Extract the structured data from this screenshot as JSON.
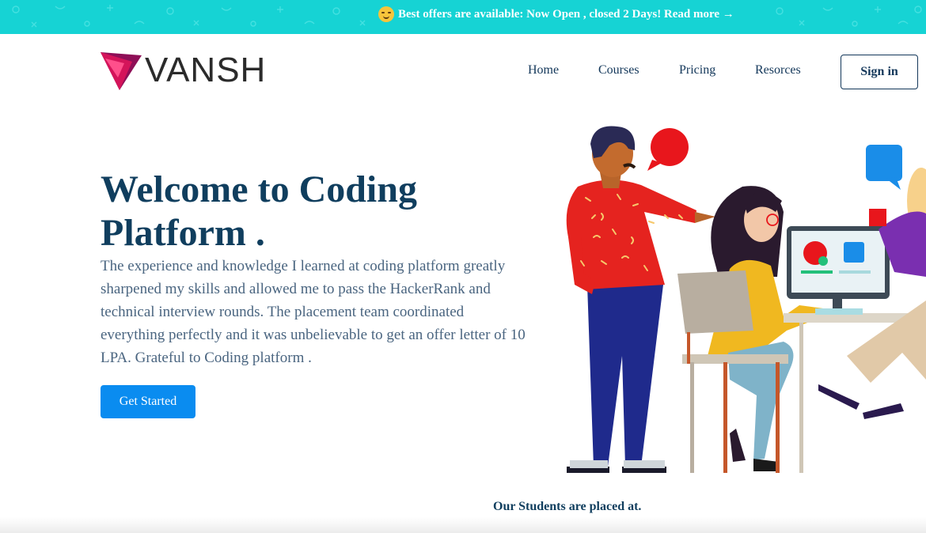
{
  "banner": {
    "text": "Best offers are available: Now Open , closed 2 Days! Read more →",
    "background": "#16d3d4",
    "icon": "grinning-face-emoji"
  },
  "header": {
    "logo_text": "VANSH",
    "nav": [
      "Home",
      "Courses",
      "Pricing",
      "Resorces"
    ],
    "signin_label": "Sign in"
  },
  "hero": {
    "title": "Welcome to Coding Platform .",
    "description": "The experience and knowledge I learned at coding platform greatly sharpened my skills and allowed me to pass the HackerRank and technical interview rounds. The placement team coordinated everything perfectly and it was unbelievable to get an offer letter of 10 LPA. Grateful to Coding platform .",
    "cta_label": "Get Started",
    "cta_color": "#0a8cf0"
  },
  "placed_heading": "Our Students are placed at.",
  "colors": {
    "heading": "#103e5e",
    "body_text": "#4a6580",
    "logo_accent": "#d4145a"
  }
}
